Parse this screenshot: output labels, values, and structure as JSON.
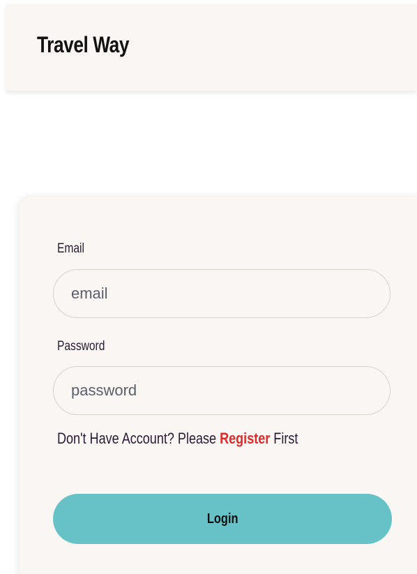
{
  "navbar": {
    "brand": "Travel Way"
  },
  "form": {
    "email_label": "Email",
    "email_placeholder": "email",
    "email_value": "",
    "password_label": "Password",
    "password_placeholder": "password",
    "password_value": "",
    "register_prefix": "Don't Have Account? Please ",
    "register_link": "Register",
    "register_suffix": " First",
    "login_label": "Login"
  },
  "colors": {
    "background": "#f9f6f3",
    "accent": "#66c2c6",
    "link": "#e02a2a",
    "text": "#2a1a33"
  }
}
